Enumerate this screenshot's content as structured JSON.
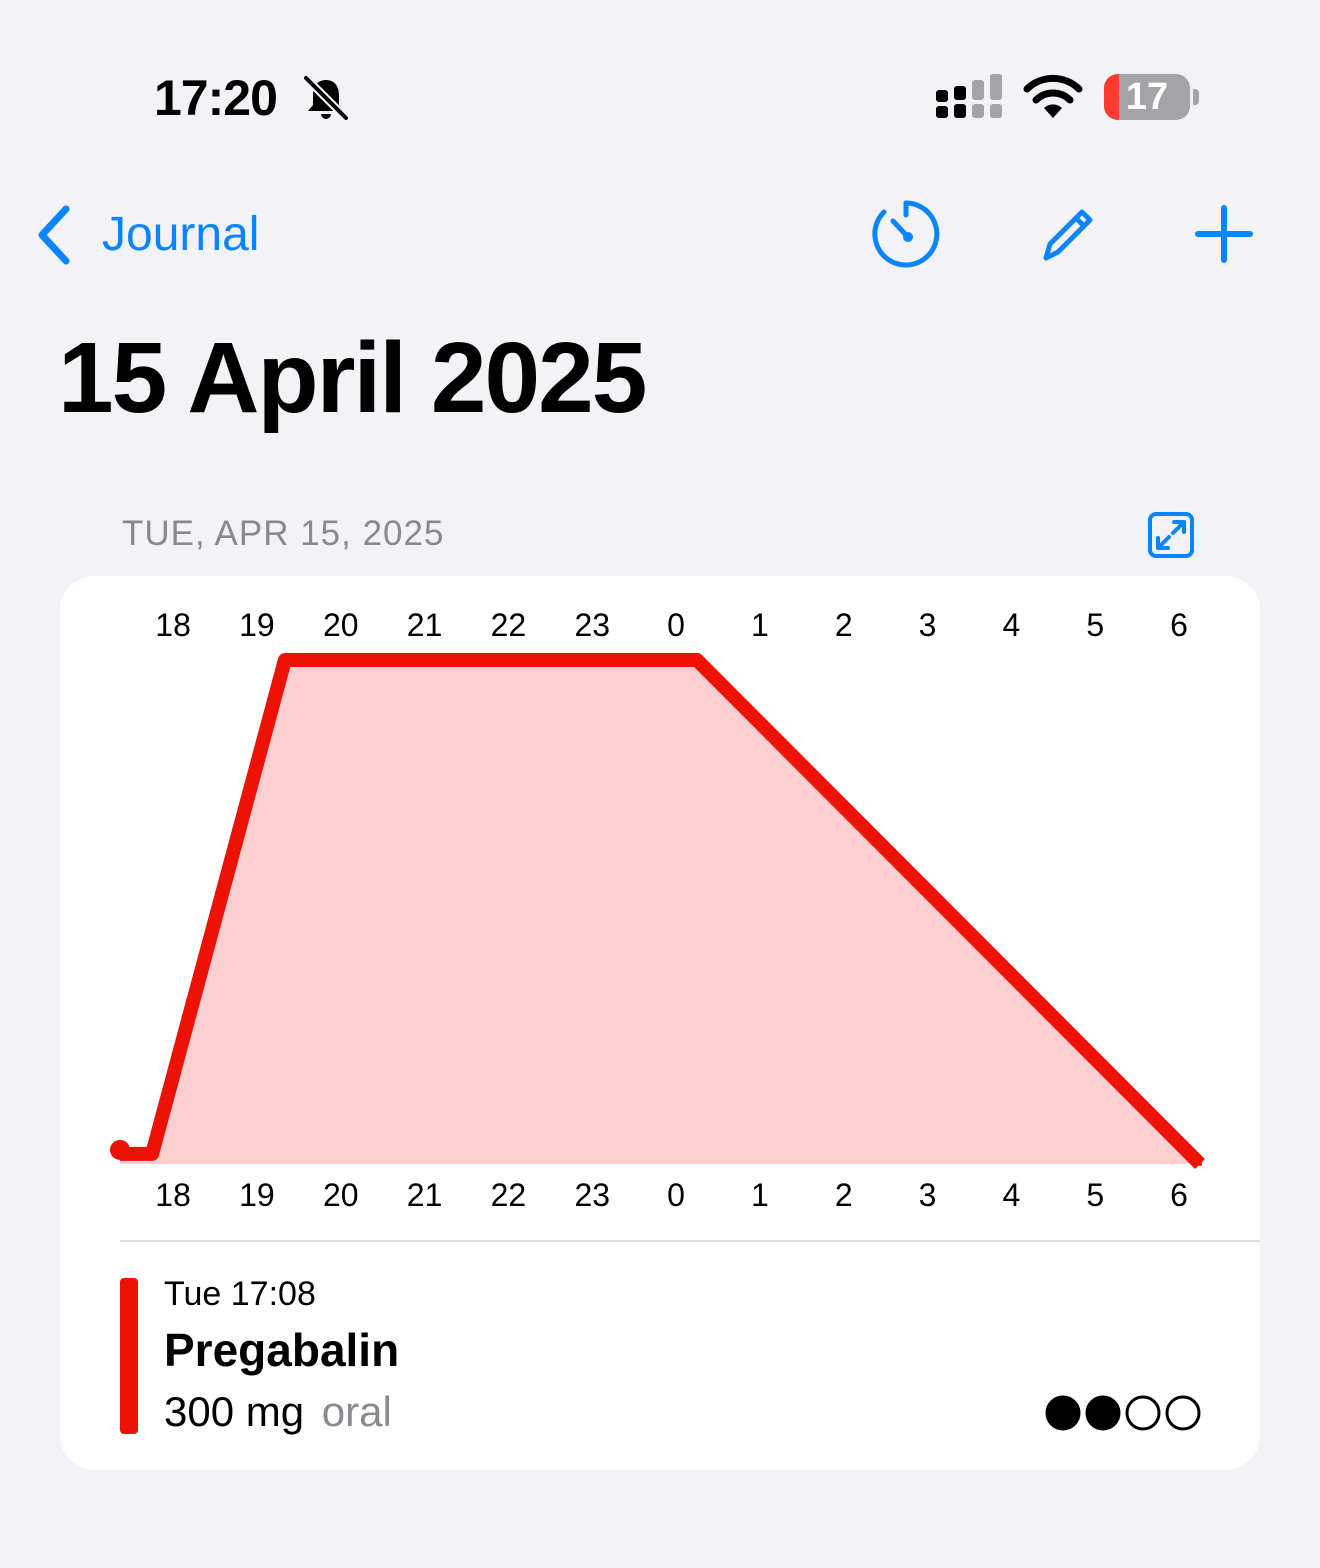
{
  "status_bar": {
    "time": "17:20",
    "icons": [
      "bell-slash-icon",
      "cellular-signal-icon",
      "wifi-icon"
    ],
    "battery_level": "17",
    "battery_fraction": 0.17
  },
  "nav": {
    "back_label": "Journal",
    "back_icon": "chevron-left-icon",
    "action_icons": [
      "timer-icon",
      "pencil-icon",
      "plus-icon"
    ],
    "accent_color": "#0a84ff"
  },
  "page_title": "15 April 2025",
  "section": {
    "header": "TUE, APR 15, 2025",
    "expand_icon": "expand-icon"
  },
  "chart_data": {
    "type": "area",
    "title": "",
    "xlabel": "",
    "ylabel": "",
    "tick_labels": [
      "18",
      "19",
      "20",
      "21",
      "22",
      "23",
      "0",
      "1",
      "2",
      "3",
      "4",
      "5",
      "6"
    ],
    "x_domain": [
      "17:22",
      "06:15"
    ],
    "y_range": [
      0,
      1
    ],
    "series": [
      {
        "color": "#ee1206",
        "fill_color": "#fbcfcf",
        "points": [
          {
            "time": "17:22",
            "level": 0.02
          },
          {
            "time": "17:45",
            "level": 0.02
          },
          {
            "time": "19:20",
            "level": 1.0
          },
          {
            "time": "00:15",
            "level": 1.0
          },
          {
            "time": "06:15",
            "level": 0.0
          }
        ]
      }
    ],
    "grid": false
  },
  "entry": {
    "time": "Tue 17:08",
    "name": "Pregabalin",
    "dose": "300 mg",
    "route": "oral",
    "color": "#ee1206",
    "rating": 2,
    "rating_max": 4
  }
}
